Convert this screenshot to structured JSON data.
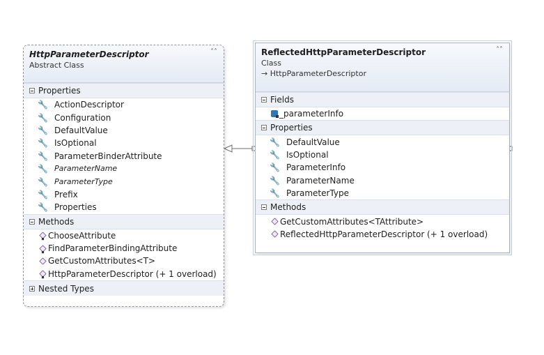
{
  "left_class": {
    "name": "HttpParameterDescriptor",
    "kind": "Abstract Class",
    "sections": [
      {
        "title": "Properties",
        "icon": "wrench-icon",
        "members": [
          {
            "label": "ActionDescriptor",
            "italic": false
          },
          {
            "label": "Configuration",
            "italic": false
          },
          {
            "label": "DefaultValue",
            "italic": false
          },
          {
            "label": "IsOptional",
            "italic": false
          },
          {
            "label": "ParameterBinderAttribute",
            "italic": false
          },
          {
            "label": "ParameterName",
            "italic": true
          },
          {
            "label": "ParameterType",
            "italic": true
          },
          {
            "label": "Prefix",
            "italic": false
          },
          {
            "label": "Properties",
            "italic": false
          }
        ]
      },
      {
        "title": "Methods",
        "icon": "method-icon",
        "members": [
          {
            "label": "ChooseAttribute",
            "italic": false
          },
          {
            "label": "FindParameterBindingAttribute",
            "italic": false
          },
          {
            "label": "GetCustomAttributes<T>",
            "italic": false
          },
          {
            "label": "HttpParameterDescriptor (+ 1 overload)",
            "italic": false
          }
        ]
      },
      {
        "title": "Nested Types",
        "collapsed": true,
        "members": []
      }
    ]
  },
  "right_class": {
    "name": "ReflectedHttpParameterDescriptor",
    "kind": "Class",
    "base": "HttpParameterDescriptor",
    "sections": [
      {
        "title": "Fields",
        "icon": "field-icon",
        "members": [
          {
            "label": "_parameterInfo",
            "italic": false
          }
        ]
      },
      {
        "title": "Properties",
        "icon": "wrench-icon",
        "members": [
          {
            "label": "DefaultValue",
            "italic": false
          },
          {
            "label": "IsOptional",
            "italic": false
          },
          {
            "label": "ParameterInfo",
            "italic": false
          },
          {
            "label": "ParameterName",
            "italic": false
          },
          {
            "label": "ParameterType",
            "italic": false
          }
        ]
      },
      {
        "title": "Methods",
        "icon": "method-icon",
        "members": [
          {
            "label": "GetCustomAttributes<TAttribute>",
            "italic": false
          },
          {
            "label": "ReflectedHttpParameterDescriptor (+ 1 overload)",
            "italic": false
          }
        ]
      }
    ]
  },
  "relationship": {
    "type": "inheritance"
  }
}
